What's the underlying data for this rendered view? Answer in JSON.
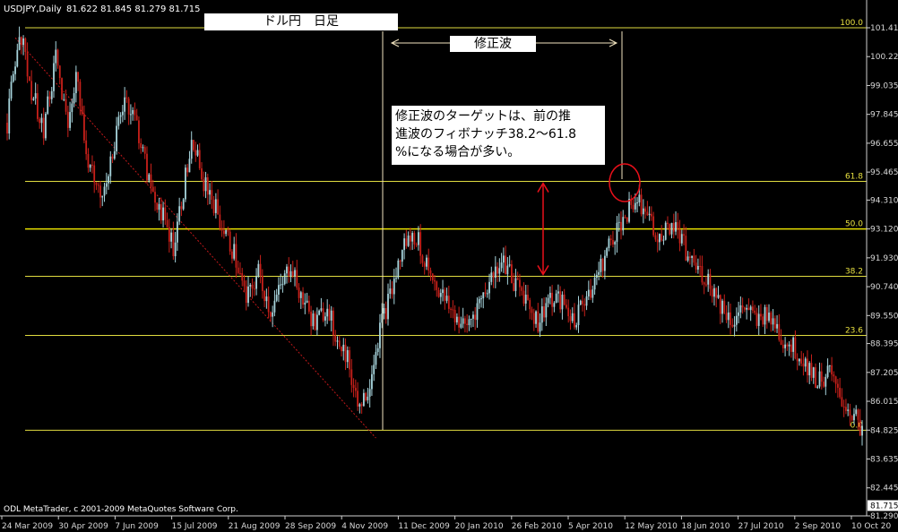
{
  "header": {
    "symbol": "USDJPY,Daily",
    "ohlc": "81.622 81.845 81.279 81.715"
  },
  "footer": "ODL MetaTrader, c 2001-2009 MetaQuotes Software Corp.",
  "annotations": {
    "title": "ドル円　日足",
    "corrective_wave": "修正波",
    "note_lines": [
      "修正波のターゲットは、前の推",
      "進波のフィボナッチ38.2～61.8",
      "%になる場合が多い。"
    ]
  },
  "colors": {
    "background": "#000000",
    "bull_candle": "#a7d4dc",
    "bear_candle": "#c8201a",
    "fibo_line": "#e0dc40",
    "fibo_50": "#e8e000",
    "trendline": "#c0181a",
    "circle": "#e8101a",
    "arrow": "#e8101a",
    "annotation_line": "#f2e4c0"
  },
  "chart_data": {
    "type": "candlestick",
    "title": "",
    "symbol": "USDJPY",
    "timeframe": "Daily",
    "last": {
      "open": 81.622,
      "high": 81.845,
      "low": 81.279,
      "close": 81.715
    },
    "y_ticks": [
      "101.415",
      "100.225",
      "99.035",
      "97.845",
      "96.655",
      "95.465",
      "94.310",
      "93.120",
      "91.930",
      "90.740",
      "89.550",
      "88.395",
      "87.205",
      "86.015",
      "84.825",
      "83.635",
      "82.445",
      "81.290"
    ],
    "ylim": [
      81.29,
      101.415
    ],
    "x_ticks": [
      "24 Mar 2009",
      "30 Apr 2009",
      "7 Jun 2009",
      "15 Jul 2009",
      "21 Aug 2009",
      "28 Sep 2009",
      "4 Nov 2009",
      "11 Dec 2009",
      "20 Jan 2010",
      "26 Feb 2010",
      "5 Apr 2010",
      "12 May 2010",
      "18 Jun 2010",
      "27 Jul 2010",
      "2 Sep 2010",
      "10 Oct 20"
    ],
    "price_marker": "81.715",
    "fibonacci_levels": [
      {
        "label": "100.0",
        "price": 101.415
      },
      {
        "label": "61.8",
        "price": 95.08
      },
      {
        "label": "50.0",
        "price": 93.12
      },
      {
        "label": "38.2",
        "price": 91.17
      },
      {
        "label": "23.6",
        "price": 88.73
      },
      {
        "label": "0.0",
        "price": 84.82
      }
    ],
    "path": [
      {
        "x": 0,
        "y": 97.5
      },
      {
        "x": 6,
        "y": 101.4
      },
      {
        "x": 12,
        "y": 98.8
      },
      {
        "x": 18,
        "y": 97.3
      },
      {
        "x": 24,
        "y": 100.2
      },
      {
        "x": 30,
        "y": 97.2
      },
      {
        "x": 34,
        "y": 99.6
      },
      {
        "x": 40,
        "y": 96.0
      },
      {
        "x": 46,
        "y": 94.3
      },
      {
        "x": 52,
        "y": 96.4
      },
      {
        "x": 58,
        "y": 98.6
      },
      {
        "x": 64,
        "y": 97.4
      },
      {
        "x": 70,
        "y": 95.0
      },
      {
        "x": 76,
        "y": 93.9
      },
      {
        "x": 82,
        "y": 92.4
      },
      {
        "x": 88,
        "y": 95.2
      },
      {
        "x": 92,
        "y": 96.8
      },
      {
        "x": 96,
        "y": 95.3
      },
      {
        "x": 100,
        "y": 94.6
      },
      {
        "x": 106,
        "y": 93.2
      },
      {
        "x": 112,
        "y": 92.1
      },
      {
        "x": 118,
        "y": 90.1
      },
      {
        "x": 124,
        "y": 91.3
      },
      {
        "x": 130,
        "y": 89.7
      },
      {
        "x": 136,
        "y": 90.8
      },
      {
        "x": 140,
        "y": 91.7
      },
      {
        "x": 146,
        "y": 90.2
      },
      {
        "x": 152,
        "y": 89.1
      },
      {
        "x": 158,
        "y": 90.0
      },
      {
        "x": 162,
        "y": 88.9
      },
      {
        "x": 168,
        "y": 87.8
      },
      {
        "x": 174,
        "y": 85.8
      },
      {
        "x": 178,
        "y": 86.5
      },
      {
        "x": 184,
        "y": 89.0
      },
      {
        "x": 190,
        "y": 90.6
      },
      {
        "x": 196,
        "y": 92.5
      },
      {
        "x": 202,
        "y": 92.8
      },
      {
        "x": 208,
        "y": 91.5
      },
      {
        "x": 214,
        "y": 90.4
      },
      {
        "x": 220,
        "y": 89.6
      },
      {
        "x": 226,
        "y": 89.0
      },
      {
        "x": 232,
        "y": 89.9
      },
      {
        "x": 238,
        "y": 90.9
      },
      {
        "x": 244,
        "y": 91.9
      },
      {
        "x": 250,
        "y": 91.0
      },
      {
        "x": 256,
        "y": 90.3
      },
      {
        "x": 262,
        "y": 89.2
      },
      {
        "x": 268,
        "y": 90.4
      },
      {
        "x": 274,
        "y": 90.0
      },
      {
        "x": 280,
        "y": 89.3
      },
      {
        "x": 286,
        "y": 90.4
      },
      {
        "x": 292,
        "y": 91.3
      },
      {
        "x": 298,
        "y": 92.6
      },
      {
        "x": 304,
        "y": 93.6
      },
      {
        "x": 310,
        "y": 94.3
      },
      {
        "x": 316,
        "y": 94.0
      },
      {
        "x": 322,
        "y": 92.6
      },
      {
        "x": 328,
        "y": 93.4
      },
      {
        "x": 334,
        "y": 92.4
      },
      {
        "x": 340,
        "y": 91.5
      },
      {
        "x": 346,
        "y": 91.0
      },
      {
        "x": 352,
        "y": 90.0
      },
      {
        "x": 358,
        "y": 89.3
      },
      {
        "x": 364,
        "y": 89.9
      },
      {
        "x": 370,
        "y": 89.2
      },
      {
        "x": 376,
        "y": 89.8
      },
      {
        "x": 382,
        "y": 88.6
      },
      {
        "x": 388,
        "y": 88.2
      },
      {
        "x": 394,
        "y": 87.6
      },
      {
        "x": 400,
        "y": 86.8
      },
      {
        "x": 406,
        "y": 87.2
      },
      {
        "x": 410,
        "y": 86.2
      },
      {
        "x": 416,
        "y": 85.6
      },
      {
        "x": 422,
        "y": 84.9
      }
    ]
  }
}
